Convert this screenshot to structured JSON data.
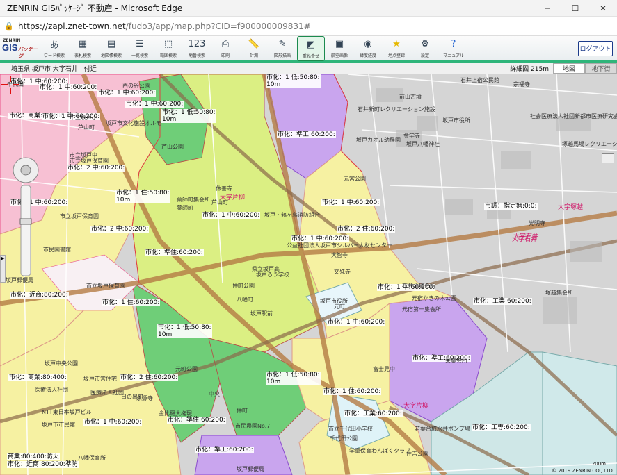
{
  "window": {
    "title": "ZENRIN GISﾊﾟｯｹｰｼﾞ 不動産 - Microsoft Edge",
    "min": "─",
    "max": "☐",
    "close": "✕"
  },
  "address": {
    "url_host": "https://zapl.znet-town.net",
    "url_path": "/fudo3/app/map.php?CID=f900000009831#"
  },
  "logo": {
    "line1": "ZENRIN",
    "line2": "GIS",
    "line3": "パッケージ"
  },
  "toolbar": {
    "tools": [
      {
        "label": "ワード検索",
        "icon": "word-search-icon"
      },
      {
        "label": "表札検索",
        "icon": "nameplate-search-icon"
      },
      {
        "label": "地図帳検索",
        "icon": "atlas-search-icon"
      },
      {
        "label": "一覧検索",
        "icon": "list-search-icon"
      },
      {
        "label": "範囲検索",
        "icon": "area-search-icon"
      },
      {
        "label": "地番検索",
        "icon": "lot-search-icon"
      },
      {
        "label": "印刷",
        "icon": "print-icon"
      },
      {
        "label": "計測",
        "icon": "measure-icon"
      },
      {
        "label": "図形描画",
        "icon": "draw-icon"
      },
      {
        "label": "重ね合せ",
        "icon": "overlay-icon"
      },
      {
        "label": "航空画像",
        "icon": "aerial-icon"
      },
      {
        "label": "緯度経度",
        "icon": "latlon-icon"
      },
      {
        "label": "地点登録",
        "icon": "star-icon"
      },
      {
        "label": "設定",
        "icon": "gear-icon"
      },
      {
        "label": "マニュアル",
        "icon": "help-icon"
      }
    ],
    "logout": "ログアウト"
  },
  "infobar": {
    "address": "埼玉県 坂戸市 大字石井　付近",
    "scale_label": "詳細図",
    "scale_value": "215m",
    "tab_map": "地図",
    "tab_street": "地下街"
  },
  "zoning_labels": [
    {
      "t": "市化：1 中:60:200:"
    },
    {
      "t": "市化：1 中:60:200:"
    },
    {
      "t": "市化：1 中:60:200:"
    },
    {
      "t": "市化：商業:80:400:防火"
    },
    {
      "t": "市化：1 低:50:80:\n10m"
    },
    {
      "t": "市化：1 低:50:80:\n10m"
    },
    {
      "t": "市化：準工:60:200:"
    },
    {
      "t": "市化：2 中:60:200:"
    },
    {
      "t": "市化：1 住:50:80:\n10m"
    },
    {
      "t": "市化：1 中:60:200:"
    },
    {
      "t": "市化：1 中:60:200:"
    },
    {
      "t": "市化：準住:60:200:"
    },
    {
      "t": "市化：2 中:60:200:"
    },
    {
      "t": "市化：1 中:60:200:"
    },
    {
      "t": "市化：2 住:60:200:"
    },
    {
      "t": "市調：指定無:0:0:"
    },
    {
      "t": "市化：1 中:60:200:"
    },
    {
      "t": "市化：近商:80:200:"
    },
    {
      "t": "市化：1 住:60:200:"
    },
    {
      "t": "市化：1 中:60:200:"
    },
    {
      "t": "市化：工業:60:200:"
    },
    {
      "t": "市化：1 低:50:80:\n10m"
    },
    {
      "t": "市化：1 中:60:200:"
    },
    {
      "t": "市化：商業:80:400:"
    },
    {
      "t": "市化：2 住:60:200:"
    },
    {
      "t": "市化：準工:60:200:"
    },
    {
      "t": "市化：1 低:50:80:\n10m"
    },
    {
      "t": "市化：1 住:60:200:"
    },
    {
      "t": "市化：工業:60:200:"
    },
    {
      "t": "市化：準住:60:200:"
    },
    {
      "t": "市化：1 中:60:200:"
    },
    {
      "t": "市化：工専:60:200:"
    },
    {
      "t": "商業:80:400:防火"
    },
    {
      "t": "市化：近商:80:200:準防"
    },
    {
      "t": "市化：準工:60:200:"
    },
    {
      "t": "市化：1 中:60:200:"
    },
    {
      "t": "市化：1 中:60:200:"
    }
  ],
  "places": [
    "西の谷公園",
    "市立坂戸小",
    "坂戸市文化施設オルモ",
    "芦山公園",
    "芦山町",
    "市立坂戸中",
    "市立坂戸保育園",
    "市民図書館",
    "坂戸郵便局",
    "市立坂戸保育園",
    "休善寺",
    "薬師町集会所",
    "坂戸・鶴ヶ島消防組合",
    "公益社団法人坂戸市シルバー人材センター",
    "大智寺",
    "文殊寺",
    "県立坂戸高",
    "坂戸ろう学校",
    "仲町公園",
    "坂戸市役所",
    "石井新町レクリエーション施設",
    "坂戸カオル幼稚園",
    "金学寺",
    "坂戸八幡神社",
    "元宮公園",
    "石井上宿公民館",
    "宗福寺",
    "前山古墳",
    "社会医療法人社団新都市医療研究会関越",
    "坂戸市役所",
    "塚越馬場レクリエーション施設",
    "光明寺",
    "塚越集会所",
    "石井北集会所",
    "元宿かきの木公園",
    "元宿第一集会所",
    "富士見中",
    "栄集会所",
    "坂戸中央公園",
    "市立千代田小学校",
    "千代田公園",
    "学童保育わんぱくクラブ",
    "若葉台取水井ポンプ場",
    "住吉公園",
    "市民農園No.7",
    "坂戸郵便局",
    "八幡保育所",
    "市立坂戸保育園",
    "医療法人社団",
    "NTT東日本坂戸ビル",
    "坂戸市市民館",
    "医療法人社団",
    "金比羅大権現",
    "坂戸市営住宅",
    "永源寺",
    "元町公園",
    "坂戸駅前",
    "日の出町",
    "八幡町",
    "中央",
    "元町",
    "芦山町",
    "薬師町",
    "仲町",
    "千代田"
  ],
  "areas": [
    "大字片柳",
    "大字石井",
    "大字塚越",
    "大字石井",
    "大字片柳"
  ],
  "map_footer": {
    "scale": "200m",
    "copyright": "© 2019 ZENRIN CO., LTD."
  }
}
